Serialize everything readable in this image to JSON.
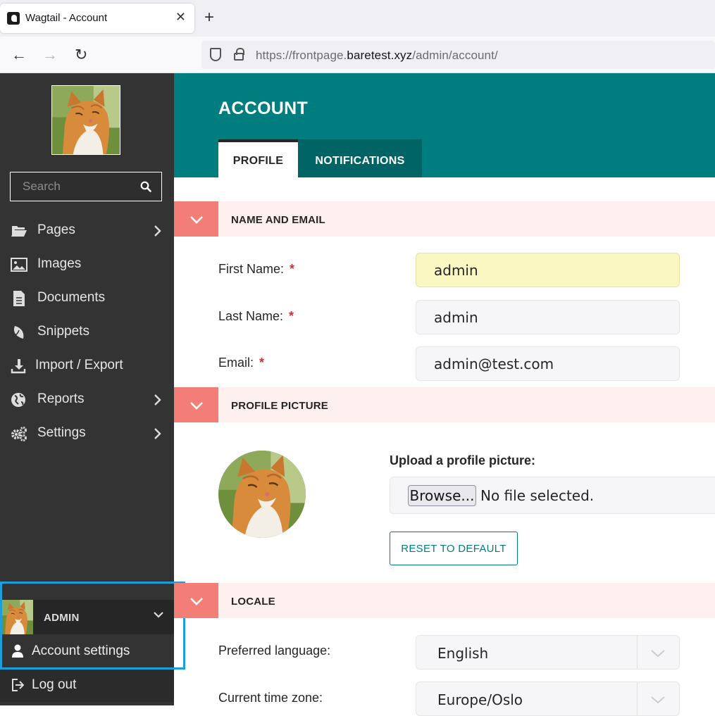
{
  "browser": {
    "tab_title": "Wagtail - Account",
    "url_prefix": "https://frontpage.",
    "url_host": "baretest.xyz",
    "url_path": "/admin/account/"
  },
  "sidebar": {
    "search_placeholder": "Search",
    "items": [
      {
        "label": "Pages",
        "icon": "folder-open-icon",
        "has_submenu": true
      },
      {
        "label": "Images",
        "icon": "image-icon",
        "has_submenu": false
      },
      {
        "label": "Documents",
        "icon": "document-icon",
        "has_submenu": false
      },
      {
        "label": "Snippets",
        "icon": "snippet-icon",
        "has_submenu": false
      },
      {
        "label": "Import / Export",
        "icon": "download-icon",
        "has_submenu": false
      },
      {
        "label": "Reports",
        "icon": "globe-icon",
        "has_submenu": true
      },
      {
        "label": "Settings",
        "icon": "cogs-icon",
        "has_submenu": true
      }
    ],
    "user": {
      "name": "ADMIN",
      "account_settings": "Account settings",
      "logout": "Log out"
    }
  },
  "header": {
    "title": "ACCOUNT",
    "tabs": [
      {
        "label": "PROFILE",
        "active": true
      },
      {
        "label": "NOTIFICATIONS",
        "active": false
      }
    ]
  },
  "sections": {
    "name_email": {
      "title": "NAME AND EMAIL",
      "first_name_label": "First Name:",
      "first_name_value": "admin",
      "last_name_label": "Last Name:",
      "last_name_value": "admin",
      "email_label": "Email:",
      "email_value": "admin@test.com",
      "required_mark": "*"
    },
    "profile_picture": {
      "title": "PROFILE PICTURE",
      "upload_label": "Upload a profile picture:",
      "browse_label": "Browse...",
      "file_status": "No file selected.",
      "reset_label": "RESET TO DEFAULT"
    },
    "locale": {
      "title": "LOCALE",
      "language_label": "Preferred language:",
      "language_value": "English",
      "timezone_label": "Current time zone:",
      "timezone_value": "Europe/Oslo"
    }
  },
  "colors": {
    "sidebar_bg": "#333333",
    "header_teal": "#007d7e",
    "section_bg": "#fdf0ef",
    "section_toggle": "#f37e77",
    "highlight": "#1c9ddc",
    "focused_input": "#fbf7c2"
  }
}
